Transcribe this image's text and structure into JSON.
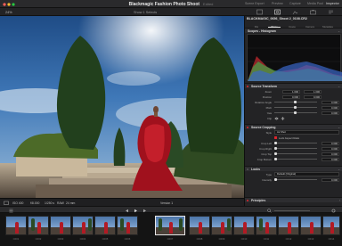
{
  "window": {
    "title": "Blackmagic Fashion Photo Shoot",
    "edited": "Edited"
  },
  "titlebar_right": [
    "Scene Export",
    "Preview",
    "Capture",
    "Media Pool",
    "Inspector"
  ],
  "toolbar": {
    "zoom": "24%",
    "selection": "Show 1 Selects"
  },
  "viewer": {
    "info": [
      "ISO 400",
      "f/8.000",
      "1/250 s",
      "RAW",
      "24 mm"
    ],
    "counter": "Version 1"
  },
  "inspector": {
    "filename": "BLACKMAGIC_0656_Shoot 2_0108.CR2",
    "tabs": [
      "File",
      "Photo",
      "Image",
      "Camera",
      "Metadata"
    ],
    "scopes_label": "Scopes - Histogram",
    "transform": {
      "title": "Source Transform",
      "rows": [
        {
          "label": "Zoom",
          "value": "1.000",
          "value2": "1.000"
        },
        {
          "label": "Position",
          "value": "0.000",
          "value2": "0.000"
        },
        {
          "label": "Rotation Angle",
          "value": "0.000"
        },
        {
          "label": "Pitch",
          "value": "0.000"
        },
        {
          "label": "Yaw",
          "value": "0.000"
        },
        {
          "label": "Flip",
          "value": ""
        }
      ]
    },
    "cropping": {
      "title": "Source Cropping",
      "style_label": "Style",
      "style_value": "As Shot",
      "lock_label": "Lock Aspect Ratio",
      "rows": [
        {
          "label": "Crop Left",
          "value": "0.000"
        },
        {
          "label": "Crop Right",
          "value": "0.000"
        },
        {
          "label": "Crop Top",
          "value": "0.000"
        },
        {
          "label": "Crop Bottom",
          "value": "0.000"
        }
      ]
    },
    "looks": {
      "title": "Looks",
      "type_label": "Type",
      "type_value": "Default (Original)",
      "intensity_label": "Intensity",
      "intensity_value": "0.000"
    },
    "composite": {
      "title": "Principles"
    }
  },
  "filmstrip": {
    "labels": [
      "C001",
      "C002",
      "C003",
      "C004",
      "C005",
      "C006",
      "C007",
      "C008",
      "C009",
      "C010",
      "C011",
      "C012",
      "C013",
      "C014",
      "C015"
    ]
  }
}
